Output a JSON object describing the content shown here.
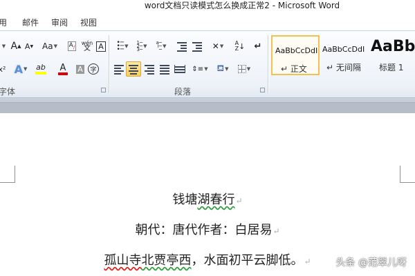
{
  "window": {
    "title": "word文档只读模式怎么换成正常2 - Microsoft Word"
  },
  "tabs": [
    {
      "label": "用"
    },
    {
      "label": "邮件"
    },
    {
      "label": "审阅"
    },
    {
      "label": "视图"
    }
  ],
  "font_group": {
    "label": "字体",
    "grow_font": "A",
    "shrink_font": "A",
    "change_case": "Aa",
    "phonetic_guide": "wén",
    "char_border": "A",
    "highlight": "ab",
    "font_color": "A",
    "char_shading": "A",
    "enclose_char": "字",
    "superscript": "x²",
    "text_effect": "A"
  },
  "paragraph_group": {
    "label": "段落"
  },
  "styles": [
    {
      "sample": "AaBbCcDdI",
      "name": "↵ 正文",
      "selected": true
    },
    {
      "sample": "AaBbCcDdI",
      "name": "↵ 无间隔",
      "selected": false
    },
    {
      "sample": "AaBb",
      "name": "标题 1",
      "selected": false
    }
  ],
  "document": {
    "lines": [
      {
        "pre": "钱塘",
        "ul": "湖春行",
        "post": ""
      },
      {
        "pre": "朝代：唐代作者：白居易",
        "ul": "",
        "post": ""
      },
      {
        "pre": "孤山寺",
        "ul": "北贾亭西",
        "post": "，水面初平云脚低。"
      }
    ],
    "paragraph_mark": "↵"
  },
  "watermark": "头条 @范翠儿呀",
  "colors": {
    "ribbon_bg": "#eef2f8",
    "selected_style_border": "#f1c251",
    "active_button": "#f8cf5d",
    "spellcheck_red": "#e02020",
    "grammar_green": "#2e9e3f",
    "font_color_red": "#e00000",
    "highlight_yellow": "#ffff00"
  }
}
